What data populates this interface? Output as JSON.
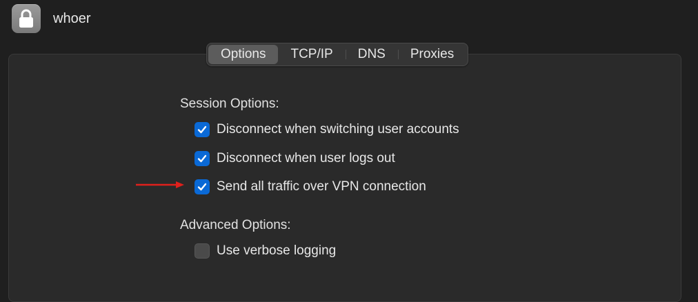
{
  "window": {
    "title": "whoer",
    "icon": "lock-icon"
  },
  "tabs": [
    {
      "label": "Options",
      "active": true
    },
    {
      "label": "TCP/IP",
      "active": false
    },
    {
      "label": "DNS",
      "active": false
    },
    {
      "label": "Proxies",
      "active": false
    }
  ],
  "session": {
    "label": "Session Options:",
    "options": [
      {
        "label": "Disconnect when switching user accounts",
        "checked": true
      },
      {
        "label": "Disconnect when user logs out",
        "checked": true
      },
      {
        "label": "Send all traffic over VPN connection",
        "checked": true
      }
    ]
  },
  "advanced": {
    "label": "Advanced Options:",
    "options": [
      {
        "label": "Use verbose logging",
        "checked": false
      }
    ]
  },
  "annotation": {
    "arrow_color": "#e0201c",
    "points_to": "Send all traffic over VPN connection"
  },
  "colors": {
    "accent": "#0a69d6",
    "background": "#1f1f1f",
    "panel": "#2a2a2a"
  }
}
